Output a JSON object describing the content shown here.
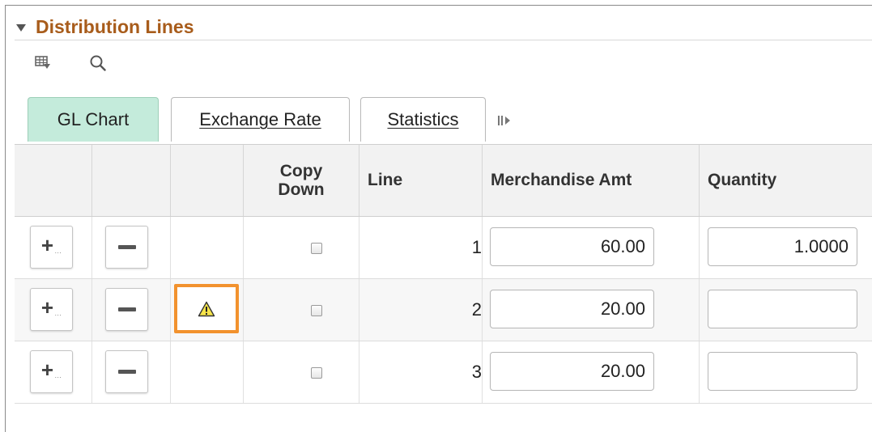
{
  "section": {
    "title": "Distribution Lines"
  },
  "toolbar": {
    "icons": [
      "grid-personalize-icon",
      "search-icon"
    ]
  },
  "tabs": [
    {
      "label": "GL Chart",
      "active": true
    },
    {
      "label": "Exchange Rate",
      "active": false
    },
    {
      "label": "Statistics",
      "active": false
    }
  ],
  "table": {
    "columns": {
      "copy_down": "Copy\nDown",
      "line": "Line",
      "merchandise_amt": "Merchandise Amt",
      "quantity": "Quantity"
    },
    "rows": [
      {
        "line": "1",
        "merchandise_amt": "60.00",
        "quantity": "1.0000",
        "warning": false,
        "copy_down": false
      },
      {
        "line": "2",
        "merchandise_amt": "20.00",
        "quantity": "",
        "warning": true,
        "copy_down": false
      },
      {
        "line": "3",
        "merchandise_amt": "20.00",
        "quantity": "",
        "warning": false,
        "copy_down": false
      }
    ]
  },
  "colors": {
    "header_text": "#a85c1b",
    "active_tab": "#c4ebdb",
    "warning_highlight": "#f2922e"
  }
}
